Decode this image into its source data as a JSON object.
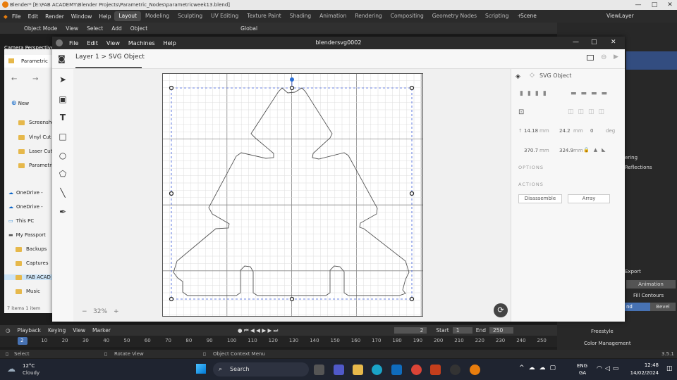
{
  "window": {
    "title": "Blender* [E:\\FAB ACADEMY\\Blender Projects\\Parametric_Nodes\\parametricweek13.blend]",
    "controls": [
      "—",
      "□",
      "✕"
    ]
  },
  "blender_menu": {
    "items": [
      "File",
      "Edit",
      "Render",
      "Window",
      "Help"
    ],
    "workspaces": [
      "Layout",
      "Modeling",
      "Sculpting",
      "UV Editing",
      "Texture Paint",
      "Shading",
      "Animation",
      "Rendering",
      "Compositing",
      "Geometry Nodes",
      "Scripting",
      "+"
    ],
    "scene": "Scene",
    "view_layer": "ViewLayer"
  },
  "viewport_header": {
    "mode": "Object Mode",
    "items": [
      "View",
      "Select",
      "Add",
      "Object"
    ],
    "transform": "Global",
    "camera_label": "Camera Perspective"
  },
  "explorer": {
    "tab": "Parametric",
    "new_button": "New",
    "items": [
      "Screenshot",
      "Vinyl Cut",
      "Laser Cut",
      "Parametric",
      "OneDrive -",
      "OneDrive -",
      "This PC",
      "My Passport",
      "Backups",
      "Captures",
      "FAB ACAD",
      "Music"
    ],
    "footer": "7 items   1 item"
  },
  "svg_app": {
    "menu": [
      "File",
      "Edit",
      "View",
      "Machines",
      "Help"
    ],
    "title": "blendersvg0002",
    "breadcrumb": "Layer 1 > SVG Object",
    "zoom": "32%",
    "zoom_minus": "−",
    "zoom_plus": "+",
    "props": {
      "title": "SVG Object",
      "x": "14.18",
      "y": "24.2",
      "rot": "0",
      "w": "370.7",
      "h": "324.9",
      "unit": "mm",
      "deg": "deg",
      "options_label": "OPTIONS",
      "actions_label": "ACTIONS",
      "disassemble": "Disassemble",
      "array": "Array"
    }
  },
  "right_panel": {
    "items": [
      "ering",
      "Reflections",
      "Export",
      "Animation",
      "Fill Contours",
      "nd",
      "Bevel",
      "Freestyle",
      "Color Management"
    ]
  },
  "timeline": {
    "items": [
      "Playback",
      "Keying",
      "View",
      "Marker"
    ],
    "current_frame": "2",
    "start_label": "Start",
    "start": "1",
    "end_label": "End",
    "end": "250",
    "ticks": [
      "2",
      "10",
      "20",
      "30",
      "40",
      "50",
      "60",
      "70",
      "80",
      "90",
      "100",
      "110",
      "120",
      "130",
      "140",
      "150",
      "160",
      "170",
      "180",
      "190",
      "200",
      "210",
      "220",
      "230",
      "240",
      "250"
    ]
  },
  "statusbar": {
    "select": "Select",
    "rotate": "Rotate View",
    "context": "Object Context Menu",
    "version": "3.5.1"
  },
  "taskbar": {
    "temp": "12°C",
    "weather": "Cloudy",
    "search": "Search",
    "lang1": "ENG",
    "lang2": "GA",
    "time": "12:48",
    "date": "14/02/2024"
  },
  "colors": {
    "accent": "#4772b3",
    "blender_orange": "#e87d0d",
    "selection_dash": "#3b5bdb"
  }
}
